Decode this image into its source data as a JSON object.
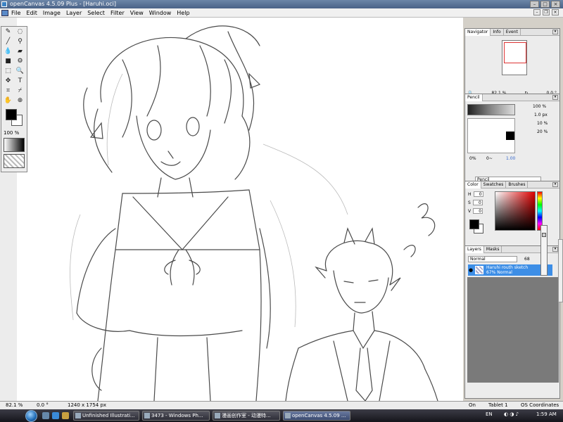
{
  "window": {
    "title": "openCanvas 4.5.09 Plus - [Haruhi.oci]"
  },
  "menu": [
    "File",
    "Edit",
    "Image",
    "Layer",
    "Select",
    "Filter",
    "View",
    "Window",
    "Help"
  ],
  "toolbox": {
    "zoom": "100",
    "unit": "%"
  },
  "navigator": {
    "tabs": [
      "Navigator",
      "Info",
      "Event"
    ],
    "zoom": "82.1",
    "zoom_unit": "%",
    "rotation": "0.0",
    "rotation_unit": "°"
  },
  "pencil": {
    "tab": "Pencil",
    "opacity": "100",
    "opacity_unit": "%",
    "size": "1.0",
    "size_unit": "px",
    "density": "10",
    "density_unit": "%",
    "min_size": "20",
    "min_unit": "%",
    "preview_a": "0%",
    "preview_b": "0~",
    "preview_c": "1.00",
    "brush_name": "Pencil"
  },
  "color": {
    "tabs": [
      "Color",
      "Swatches",
      "Brushes"
    ],
    "h_label": "H",
    "h": "0",
    "s_label": "S",
    "s": "0",
    "v_label": "V",
    "v": "0"
  },
  "layers": {
    "tabs": [
      "Layers",
      "Masks"
    ],
    "blend": "Normal",
    "opacity": "68",
    "layer_name": "Haruhi routh sketch",
    "layer_info": "67% Normal"
  },
  "statusbar": {
    "zoom": "82.1 %",
    "angle": "0.0 °",
    "size": "1240 x 1754 px",
    "state": "On",
    "device": "Tablet 1",
    "coords": "OS Coordinates"
  },
  "taskbar": {
    "buttons": [
      "Unfinished Illustrati...",
      "3473 - Windows Ph...",
      "漫画创作室 - 动漫特...",
      "openCanvas 4.5.09 ..."
    ],
    "lang": "EN",
    "time": "1:59 AM"
  }
}
